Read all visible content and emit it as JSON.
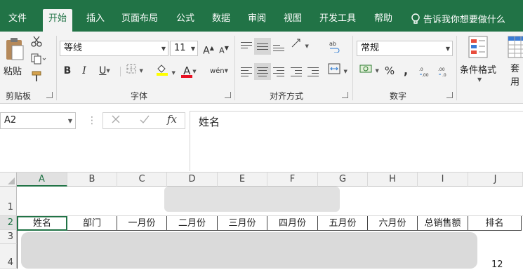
{
  "tabs": [
    {
      "label": "文件"
    },
    {
      "label": "开始"
    },
    {
      "label": "插入"
    },
    {
      "label": "页面布局"
    },
    {
      "label": "公式"
    },
    {
      "label": "数据"
    },
    {
      "label": "审阅"
    },
    {
      "label": "视图"
    },
    {
      "label": "开发工具"
    },
    {
      "label": "帮助"
    }
  ],
  "tell_me": "告诉我你想要做什么",
  "clipboard": {
    "paste_label": "粘贴",
    "group_label": "剪贴板"
  },
  "font": {
    "name": "等线",
    "size": "11",
    "group_label": "字体",
    "grow": "A",
    "shrink": "A",
    "bold": "B",
    "italic": "I",
    "underline": "U",
    "font_color": "A",
    "phonetic": "wén"
  },
  "alignment": {
    "group_label": "对齐方式"
  },
  "number": {
    "format": "常规",
    "group_label": "数字",
    "percent": "%",
    "comma": ","
  },
  "styles": {
    "conditional_format": "条件格式",
    "table_format": "套用\n表格格"
  },
  "formula_bar": {
    "name_box": "A2",
    "fx": "fx",
    "content": "姓名"
  },
  "colors": {
    "accent": "#217346",
    "font_color_bar": "#e81123",
    "fill_color_bar": "#ffff00"
  },
  "grid": {
    "columns": [
      "A",
      "B",
      "C",
      "D",
      "E",
      "F",
      "G",
      "H",
      "I",
      "J"
    ],
    "rows": [
      "1",
      "2",
      "3",
      "4"
    ],
    "row2": [
      "姓名",
      "部门",
      "一月份",
      "二月份",
      "三月份",
      "四月份",
      "五月份",
      "六月份",
      "总销售额",
      "排名"
    ],
    "j4_value": "12"
  }
}
